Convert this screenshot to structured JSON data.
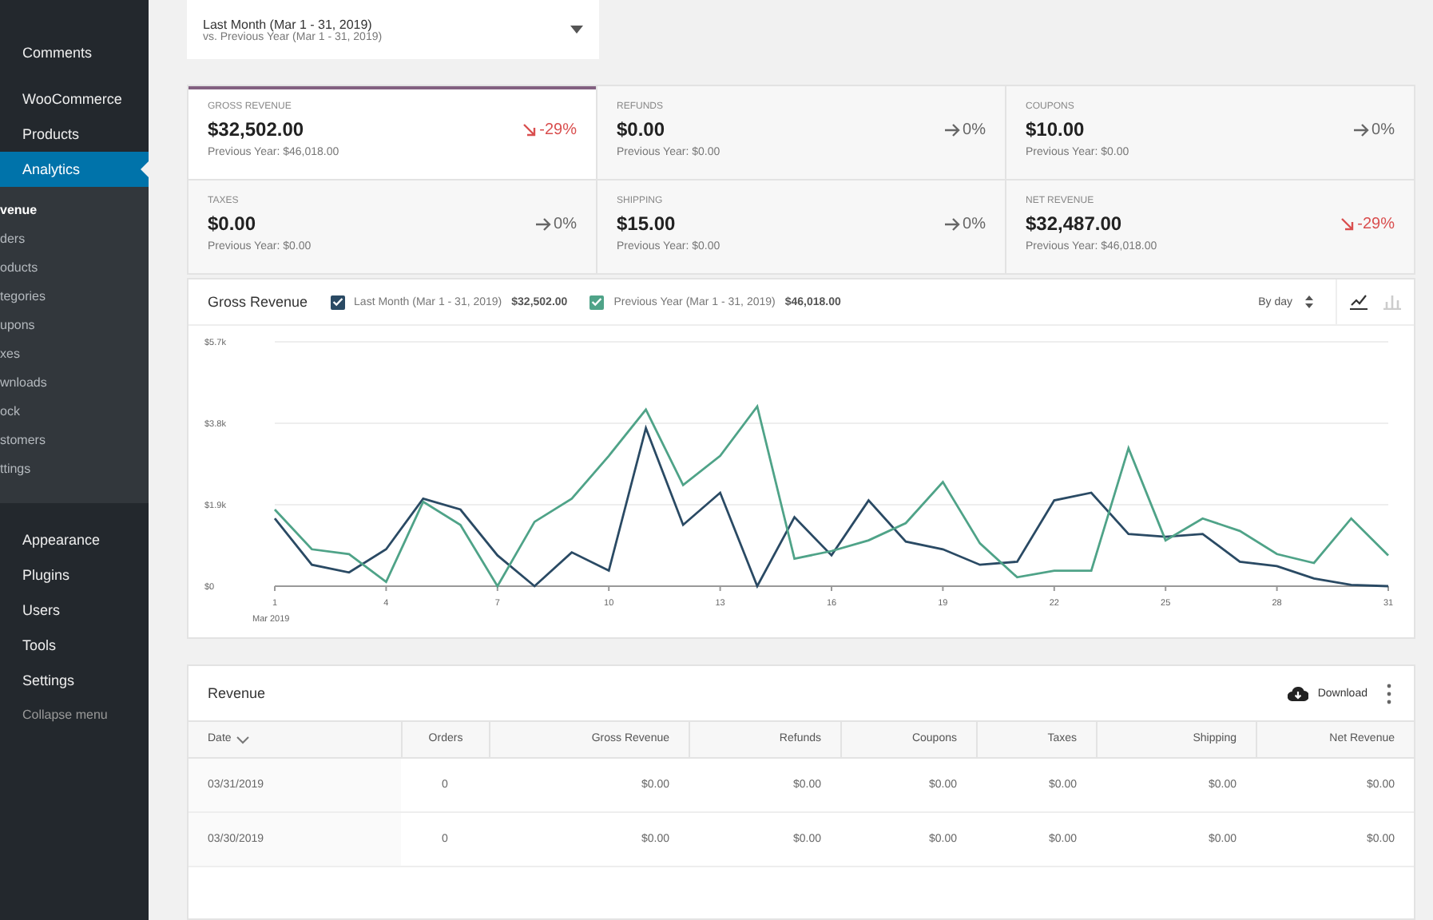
{
  "sidebar": {
    "groups": [
      [
        {
          "label": "Comments",
          "kind": "main",
          "selected": false
        }
      ],
      [
        {
          "label": "WooCommerce",
          "kind": "main",
          "selected": false
        },
        {
          "label": "Products",
          "kind": "main",
          "selected": false
        },
        {
          "label": "Analytics",
          "kind": "main",
          "selected": true,
          "children": [
            {
              "label": "venue",
              "selected": true
            },
            {
              "label": "ders",
              "selected": false
            },
            {
              "label": "oducts",
              "selected": false
            },
            {
              "label": "tegories",
              "selected": false
            },
            {
              "label": "upons",
              "selected": false
            },
            {
              "label": "xes",
              "selected": false
            },
            {
              "label": "wnloads",
              "selected": false
            },
            {
              "label": "ock",
              "selected": false
            },
            {
              "label": "stomers",
              "selected": false
            },
            {
              "label": "ttings",
              "selected": false
            }
          ]
        },
        {
          "label": "Appearance",
          "kind": "main",
          "selected": false
        },
        {
          "label": "Plugins",
          "kind": "main",
          "selected": false
        },
        {
          "label": "Users",
          "kind": "main",
          "selected": false
        },
        {
          "label": "Tools",
          "kind": "main",
          "selected": false
        },
        {
          "label": "Settings",
          "kind": "main",
          "selected": false
        },
        {
          "label": "Collapse menu",
          "kind": "collapse",
          "selected": false
        }
      ]
    ]
  },
  "date_range": {
    "primary": "Last Month (Mar 1 - 31, 2019)",
    "secondary": "vs. Previous Year (Mar 1 - 31, 2019)"
  },
  "summary": [
    {
      "label": "GROSS REVENUE",
      "value": "$32,502.00",
      "delta": "-29%",
      "kind": "down",
      "previous": "Previous Year: $46,018.00",
      "selected": true
    },
    {
      "label": "REFUNDS",
      "value": "$0.00",
      "delta": "0%",
      "kind": "flat",
      "previous": "Previous Year: $0.00",
      "selected": false
    },
    {
      "label": "COUPONS",
      "value": "$10.00",
      "delta": "0%",
      "kind": "flat",
      "previous": "Previous Year: $0.00",
      "selected": false
    },
    {
      "label": "TAXES",
      "value": "$0.00",
      "delta": "0%",
      "kind": "flat",
      "previous": "Previous Year: $0.00",
      "selected": false
    },
    {
      "label": "SHIPPING",
      "value": "$15.00",
      "delta": "0%",
      "kind": "flat",
      "previous": "Previous Year: $0.00",
      "selected": false
    },
    {
      "label": "NET REVENUE",
      "value": "$32,487.00",
      "delta": "-29%",
      "kind": "down",
      "previous": "Previous Year: $46,018.00",
      "selected": false
    }
  ],
  "chart_panel": {
    "title": "Gross Revenue",
    "legend": [
      {
        "label": "Last Month (Mar 1 - 31, 2019)",
        "total": "$32,502.00",
        "checked": true,
        "color": "#2a4a64"
      },
      {
        "label": "Previous Year (Mar 1 - 31, 2019)",
        "total": "$46,018.00",
        "checked": true,
        "color": "#4fa388"
      }
    ],
    "interval": "By day",
    "chart_types": [
      {
        "kind": "line",
        "selected": true
      },
      {
        "kind": "bar",
        "selected": false
      }
    ],
    "chart_data": {
      "type": "line",
      "xlabel": "Mar 2019",
      "x": [
        1,
        2,
        3,
        4,
        5,
        6,
        7,
        8,
        9,
        10,
        11,
        12,
        13,
        14,
        15,
        16,
        17,
        18,
        19,
        20,
        21,
        22,
        23,
        24,
        25,
        26,
        27,
        28,
        29,
        30,
        31
      ],
      "series": [
        {
          "color": "#2a4a64",
          "values": [
            1580,
            500,
            320,
            860,
            2040,
            1790,
            720,
            0,
            790,
            360,
            3690,
            1430,
            2180,
            0,
            1610,
            720,
            2000,
            1040,
            860,
            500,
            570,
            2000,
            2180,
            1220,
            1150,
            1220,
            570,
            470,
            180,
            30,
            0
          ]
        },
        {
          "color": "#4fa388",
          "values": [
            1790,
            860,
            750,
            100,
            1970,
            1430,
            0,
            1500,
            2040,
            3040,
            4120,
            2360,
            3040,
            4190,
            640,
            820,
            1070,
            1470,
            2430,
            1000,
            210,
            360,
            360,
            3220,
            1070,
            1580,
            1290,
            750,
            540,
            1580,
            720
          ]
        }
      ],
      "xlim": [
        1,
        31
      ],
      "ylim": [
        0,
        5700
      ],
      "xticks": [
        1,
        4,
        7,
        10,
        13,
        16,
        19,
        22,
        25,
        28,
        31
      ],
      "yticks": [
        {
          "value": 0,
          "label": "$0"
        },
        {
          "value": 1900,
          "label": "$1.9k"
        },
        {
          "value": 3800,
          "label": "$3.8k"
        },
        {
          "value": 5700,
          "label": "$5.7k"
        }
      ]
    }
  },
  "table": {
    "title": "Revenue",
    "download": "Download",
    "columns": [
      "Date",
      "Orders",
      "Gross Revenue",
      "Refunds",
      "Coupons",
      "Taxes",
      "Shipping",
      "Net Revenue"
    ],
    "rows": [
      [
        "03/31/2019",
        "0",
        "$0.00",
        "$0.00",
        "$0.00",
        "$0.00",
        "$0.00",
        "$0.00"
      ],
      [
        "03/30/2019",
        "0",
        "$0.00",
        "$0.00",
        "$0.00",
        "$0.00",
        "$0.00",
        "$0.00"
      ]
    ]
  }
}
